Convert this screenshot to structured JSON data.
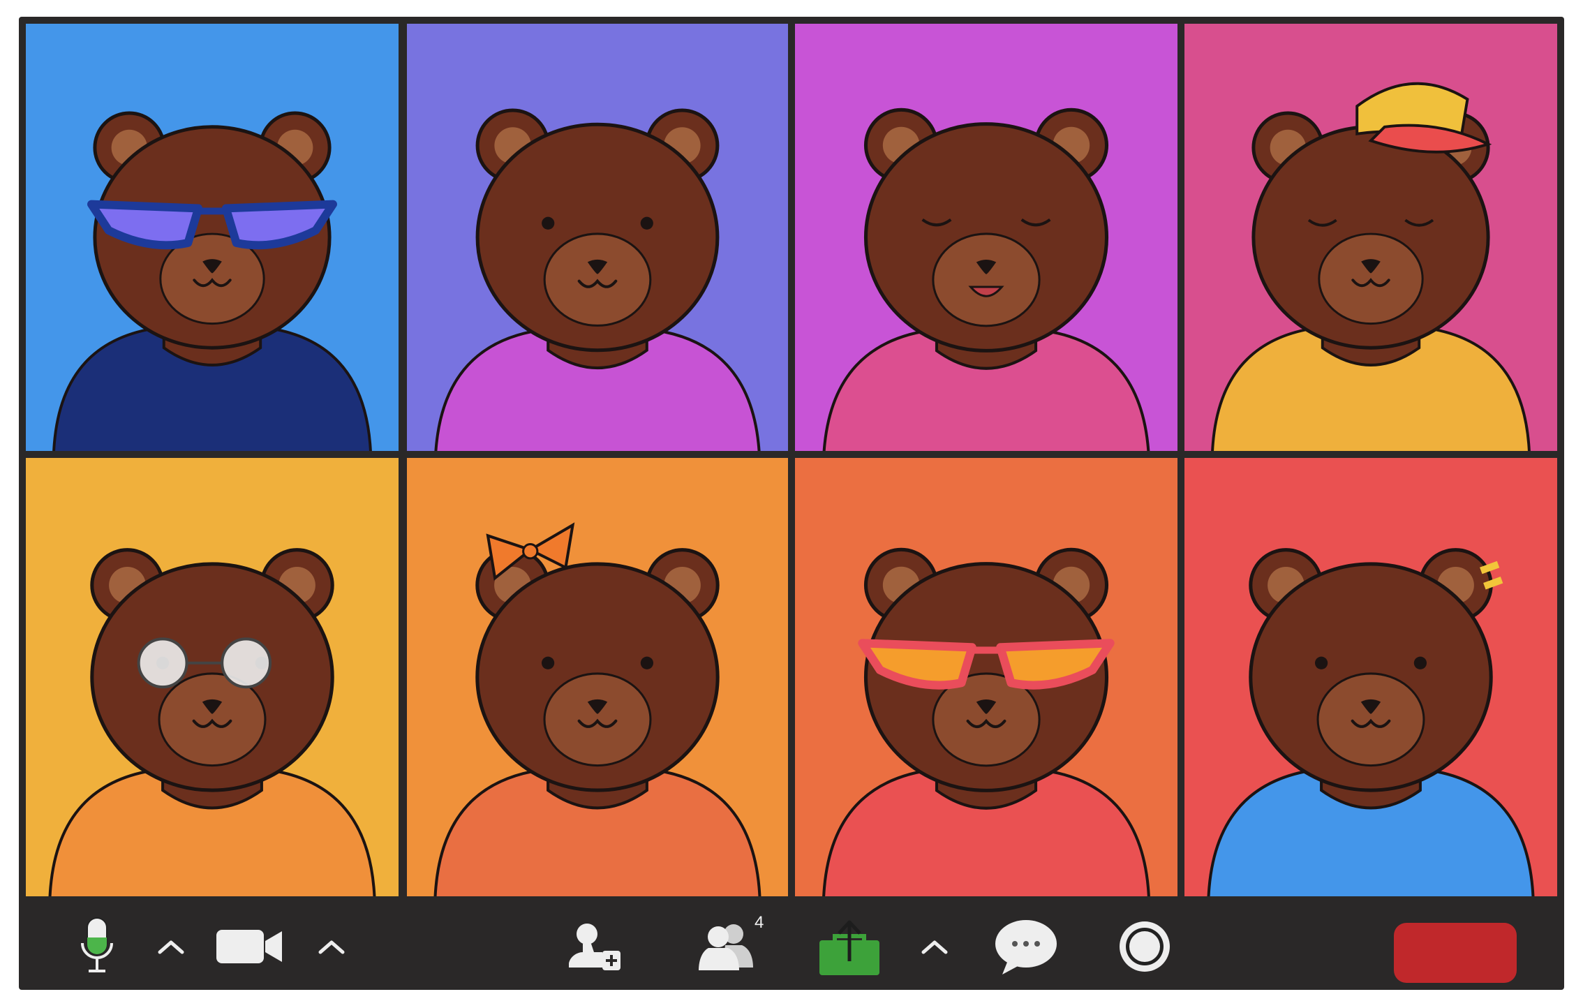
{
  "gallery": {
    "tiles": [
      {
        "bg": "#4496ea",
        "shirt": "#1b2f78",
        "accessory": "blue-cat-eye-glasses-with-chain",
        "expression": "smile"
      },
      {
        "bg": "#7873e0",
        "shirt": "#c753d4",
        "accessory": "none",
        "expression": "smile"
      },
      {
        "bg": "#c854d6",
        "shirt": "#dc4f90",
        "accessory": "none",
        "expression": "eyes-closed-smile"
      },
      {
        "bg": "#d84f8e",
        "shirt": "#efb03c",
        "accessory": "red-yellow-cap",
        "expression": "squint-smile"
      },
      {
        "bg": "#f0b03c",
        "shirt": "#f0903a",
        "accessory": "round-glasses",
        "expression": "smile"
      },
      {
        "bg": "#f0913a",
        "shirt": "#e96f42",
        "accessory": "orange-bow",
        "expression": "smile"
      },
      {
        "bg": "#eb6f41",
        "shirt": "#ea5152",
        "accessory": "orange-cat-eye-glasses",
        "expression": "smile"
      },
      {
        "bg": "#ea5151",
        "shirt": "#4496ea",
        "accessory": "yellow-hair-clip",
        "expression": "smile"
      }
    ]
  },
  "toolbar": {
    "participants_count": "4",
    "icons": {
      "mic": "microphone-icon",
      "mic_menu": "chevron-up-icon",
      "video": "video-camera-icon",
      "video_menu": "chevron-up-icon",
      "invite": "add-person-icon",
      "participants": "participants-icon",
      "share": "share-screen-icon",
      "share_menu": "chevron-up-icon",
      "chat": "chat-bubble-icon",
      "record": "record-icon",
      "end": "end-call-button"
    },
    "colors": {
      "icon": "#eeeeee",
      "mic_level": "#4cb54a",
      "share": "#3da23a",
      "end": "#c0282b"
    }
  }
}
